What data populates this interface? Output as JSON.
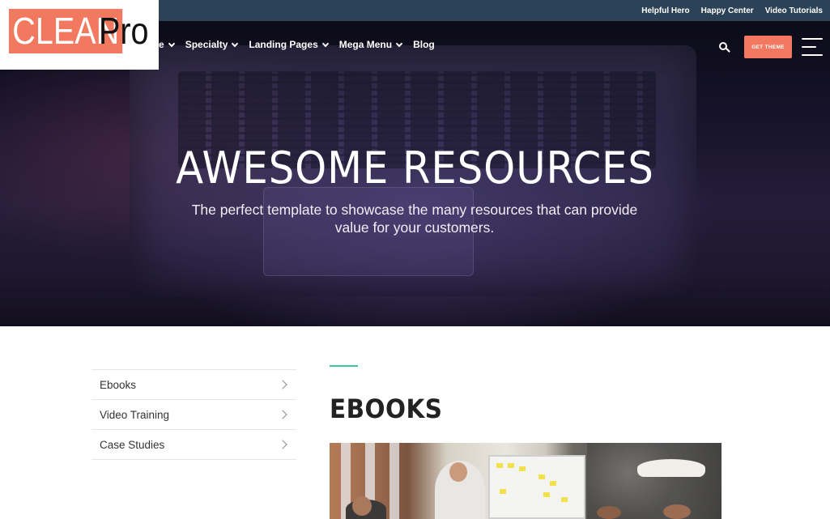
{
  "logo": {
    "part1": "CLEAN",
    "part2": "Pro"
  },
  "topbar": {
    "links": [
      "Helpful Hero",
      "Happy Center",
      "Video Tutorials"
    ]
  },
  "nav": {
    "items": [
      {
        "label": "e",
        "has_dropdown": true
      },
      {
        "label": "Specialty",
        "has_dropdown": true
      },
      {
        "label": "Landing Pages",
        "has_dropdown": true
      },
      {
        "label": "Mega Menu",
        "has_dropdown": true
      },
      {
        "label": "Blog",
        "has_dropdown": false
      }
    ],
    "search_icon": "search-icon",
    "cta_label": "GET THEME",
    "menu_icon": "hamburger-icon"
  },
  "hero": {
    "title": "AWESOME RESOURCES",
    "subtitle": "The perfect template to showcase the many resources that can provide value for your customers."
  },
  "sidebar": {
    "items": [
      {
        "label": "Ebooks"
      },
      {
        "label": "Video Training"
      },
      {
        "label": "Case Studies"
      }
    ]
  },
  "section": {
    "title": "EBOOKS"
  },
  "colors": {
    "accent": "#f27860",
    "topbar": "#2c4256",
    "divider_accent": "#35c9a6"
  }
}
